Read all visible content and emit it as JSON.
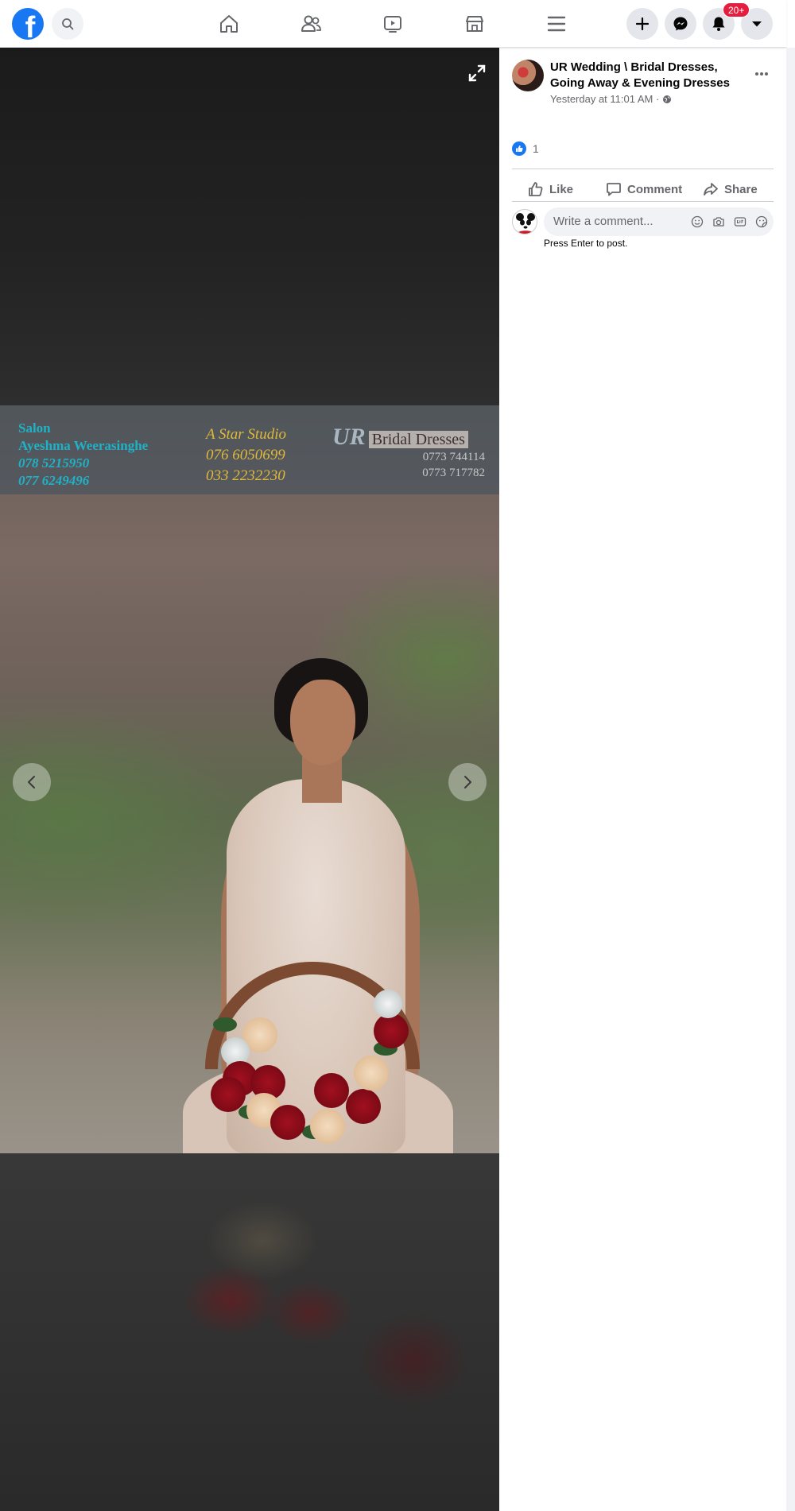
{
  "topbar": {
    "logo_letter": "f",
    "notification_count": "20+",
    "nav": [
      "home-icon",
      "friends-icon",
      "watch-icon",
      "marketplace-icon",
      "menu-icon"
    ],
    "right_buttons": [
      "plus-icon",
      "messenger-icon",
      "bell-icon",
      "caret-down-icon"
    ],
    "brand_color": "#1877f2",
    "badge_color": "#e41e3f"
  },
  "photo": {
    "watermark": {
      "salon_lines": [
        "Salon",
        "Ayeshma Weerasinghe",
        "078 5215950",
        "077 6249496"
      ],
      "studio_lines": [
        "A Star Studio",
        "076 6050699",
        "033 2232230"
      ],
      "brand_ur": "UR",
      "brand_text": "Bridal Dresses",
      "brand_phones": [
        "0773 744114",
        "0773 717782"
      ]
    }
  },
  "post": {
    "page_name": "UR Wedding \\ Bridal Dresses, Going Away & Evening Dresses",
    "time": "Yesterday at 11:01 AM ·",
    "like_count": "1",
    "actions": {
      "like": "Like",
      "comment": "Comment",
      "share": "Share"
    },
    "comment_placeholder": "Write a comment...",
    "press_enter": "Press Enter to post."
  }
}
